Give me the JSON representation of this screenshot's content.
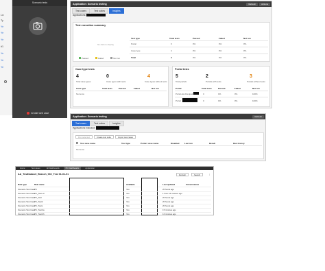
{
  "left_edge": {
    "rows": [
      "Lo:",
      "Ty",
      "Ye",
      "Ye",
      "Ye",
      "#1",
      "Ye",
      "Ye",
      "Ye"
    ]
  },
  "camera_panel": {
    "title": "Scenario tests",
    "record_label": "Create web case",
    "icon": "camera-icon"
  },
  "win1": {
    "title": "Application: Scenario testing",
    "buttons": {
      "refresh": "Refresh",
      "actions": "Actions"
    },
    "tabs": [
      "Test cases",
      "Test suites",
      "Insights"
    ],
    "active_tab": 2,
    "breadcrumb": "Applications:",
    "summary": {
      "title": "Test execution summary",
      "chart_no_data": "No data to display",
      "legend": [
        "Passed",
        "Failed",
        "Not run"
      ],
      "legend_colors": [
        "#5cb85c",
        "#e6c21a",
        "#9a9a9a"
      ],
      "columns": [
        "Test type",
        "Total tests",
        "Passed",
        "Failed",
        "Not run"
      ],
      "rows": [
        {
          "type": "Portal",
          "total": "0",
          "passed": "0%",
          "failed": "0%",
          "notrun": "0%"
        },
        {
          "type": "Case type",
          "total": "4",
          "passed": "0%",
          "failed": "0%",
          "notrun": "0%"
        },
        {
          "type": "Total",
          "total": "4",
          "passed": "0%",
          "failed": "0%",
          "notrun": "0%"
        }
      ]
    },
    "case_type_tests": {
      "title": "Case type tests",
      "stats": [
        {
          "value": "4",
          "label": "Total case types"
        },
        {
          "value": "0",
          "label": "Case types with tests"
        },
        {
          "value": "4",
          "label": "Case types without tests"
        }
      ],
      "columns": [
        "Case type",
        "Total tests",
        "Passed",
        "Failed",
        "Not run"
      ],
      "empty": "No items"
    },
    "portal_tests": {
      "title": "Portal tests",
      "stats": [
        {
          "value": "5",
          "label": "Total portals"
        },
        {
          "value": "2",
          "label": "Portals with tests"
        },
        {
          "value": "3",
          "label": "Portals without tests"
        }
      ],
      "columns": [
        "Portal",
        "Total tests",
        "Passed",
        "Failed",
        "Not run"
      ],
      "rows": [
        {
          "name": "Portal-Ext-Flexipain",
          "total": "0",
          "passed": "0%",
          "failed": "0%",
          "notrun": "100%"
        },
        {
          "name": "Portal",
          "total": "0",
          "passed": "0%",
          "failed": "0%",
          "notrun": "100%"
        }
      ]
    }
  },
  "win2": {
    "title": "Application: Scenario testing",
    "buttons": {
      "refresh": "Refresh"
    },
    "tabs": [
      "Test cases",
      "Test suites",
      "Insights"
    ],
    "active_tab": 0,
    "breadcrumb": "Applications included:",
    "toolbar": [
      "Run selected",
      "Create test suite",
      "Import test cases"
    ],
    "columns": [
      "Test case name",
      "Test type",
      "Portal / case name",
      "Disabled",
      "Last run",
      "Result",
      "Run history"
    ],
    "empty": "No items"
  },
  "win3": {
    "nav": [
      "Home",
      "Test cases",
      "All Dashboards",
      "PC Dashboards",
      "Application"
    ],
    "nav_active": 3,
    "title": "AA_TestDataset_Branch_002_Test 01-01-01",
    "buttons": {
      "refresh": "Refresh",
      "search": "Search",
      "more": "⋮"
    },
    "columns": [
      "Rule type",
      "Rule name",
      "Applies to",
      "Available",
      "Updated by",
      "Last updated",
      "Circumstance"
    ],
    "rows": [
      {
        "type": "Scenario Test Case",
        "name": "PC",
        "available": "Yes",
        "updated": "20 hours ago"
      },
      {
        "type": "Scenario Test Case",
        "name": "PC_Test v2",
        "available": "Yes",
        "updated": "1 hour 16 minutes ago"
      },
      {
        "type": "Scenario Test Case",
        "name": "PC_Test",
        "available": "Yes",
        "updated": "20 hours ago"
      },
      {
        "type": "Scenario Test Case",
        "name": "PC_Test2",
        "available": "Yes",
        "updated": "20 hours ago"
      },
      {
        "type": "Scenario Test Case",
        "name": "PC_Tests",
        "available": "Yes",
        "updated": "20 hours ago"
      },
      {
        "type": "Scenario Test Case",
        "name": "PC_TestCa",
        "available": "Yes",
        "updated": "15 minutes ago"
      },
      {
        "type": "Scenario Test Case",
        "name": "PC_TestCh",
        "available": "Yes",
        "updated": "16 minutes ago"
      }
    ]
  }
}
